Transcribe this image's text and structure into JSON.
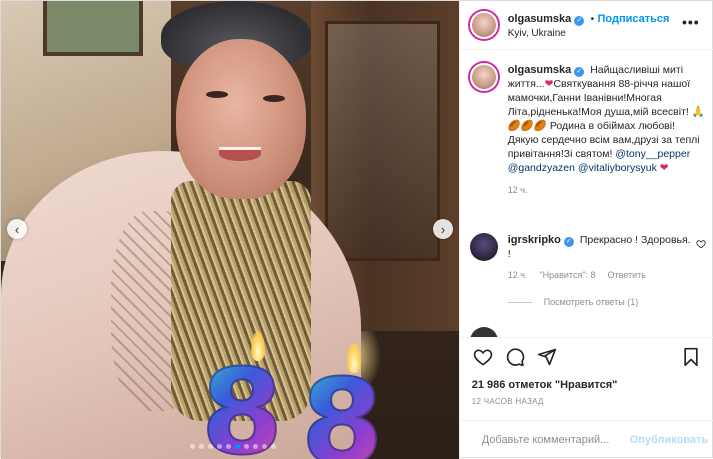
{
  "header": {
    "username": "olgasumska",
    "separator": "•",
    "follow_label": "Подписаться",
    "location": "Kyiv, Ukraine",
    "more_icon": "more-horizontal-icon"
  },
  "caption": {
    "username": "olgasumska",
    "text_1": "Найщасливіші миті життя...",
    "text_2": "Святкування 88-річчя нашої мамочки,Ганни Іванівни!Многая Літа,рідненька!Моя душа,мій всесвіт!",
    "emoji_hands": "🙏",
    "emoji_balls": "🏉🏉🏉",
    "text_3": "Родина в обіймах любові! Дякую сердечно всім вам,друзі за теплі привітання!Зі святом!",
    "mention_1": "@tony__pepper",
    "mention_2": "@gandzyazen",
    "mention_3": "@vitaliyborysyuk",
    "heart": "❤",
    "time_ago": "12 ч."
  },
  "comment": {
    "username": "igrskripko",
    "text": "Прекрасно ! Здоровья. !",
    "time_ago": "12 ч.",
    "likes_text": "\"Нравится\": 8",
    "reply_label": "Ответить",
    "view_replies": "Посмотреть ответы (1)",
    "like_icon": "heart-outline-icon"
  },
  "photo": {
    "candle_1": "8",
    "candle_2": "8",
    "prev_arrow": "‹",
    "next_arrow": "›",
    "dots_count": 10,
    "active_dot": 5
  },
  "actions": {
    "like_icon": "heart-outline-icon",
    "comment_icon": "comment-bubble-icon",
    "share_icon": "paper-plane-icon",
    "save_icon": "bookmark-icon"
  },
  "likes_text": "21 986 отметок \"Нравится\"",
  "timestamp": "12 ЧАСОВ НАЗАД",
  "add_comment": {
    "placeholder": "Добавьте комментарий...",
    "publish_label": "Опубликовать",
    "emoji_icon": "smiley-icon"
  },
  "colors": {
    "accent": "#0095f6",
    "verified": "#3897f0",
    "text": "#262626",
    "muted": "#8e8e8e",
    "publish_disabled": "#b2dffc"
  }
}
